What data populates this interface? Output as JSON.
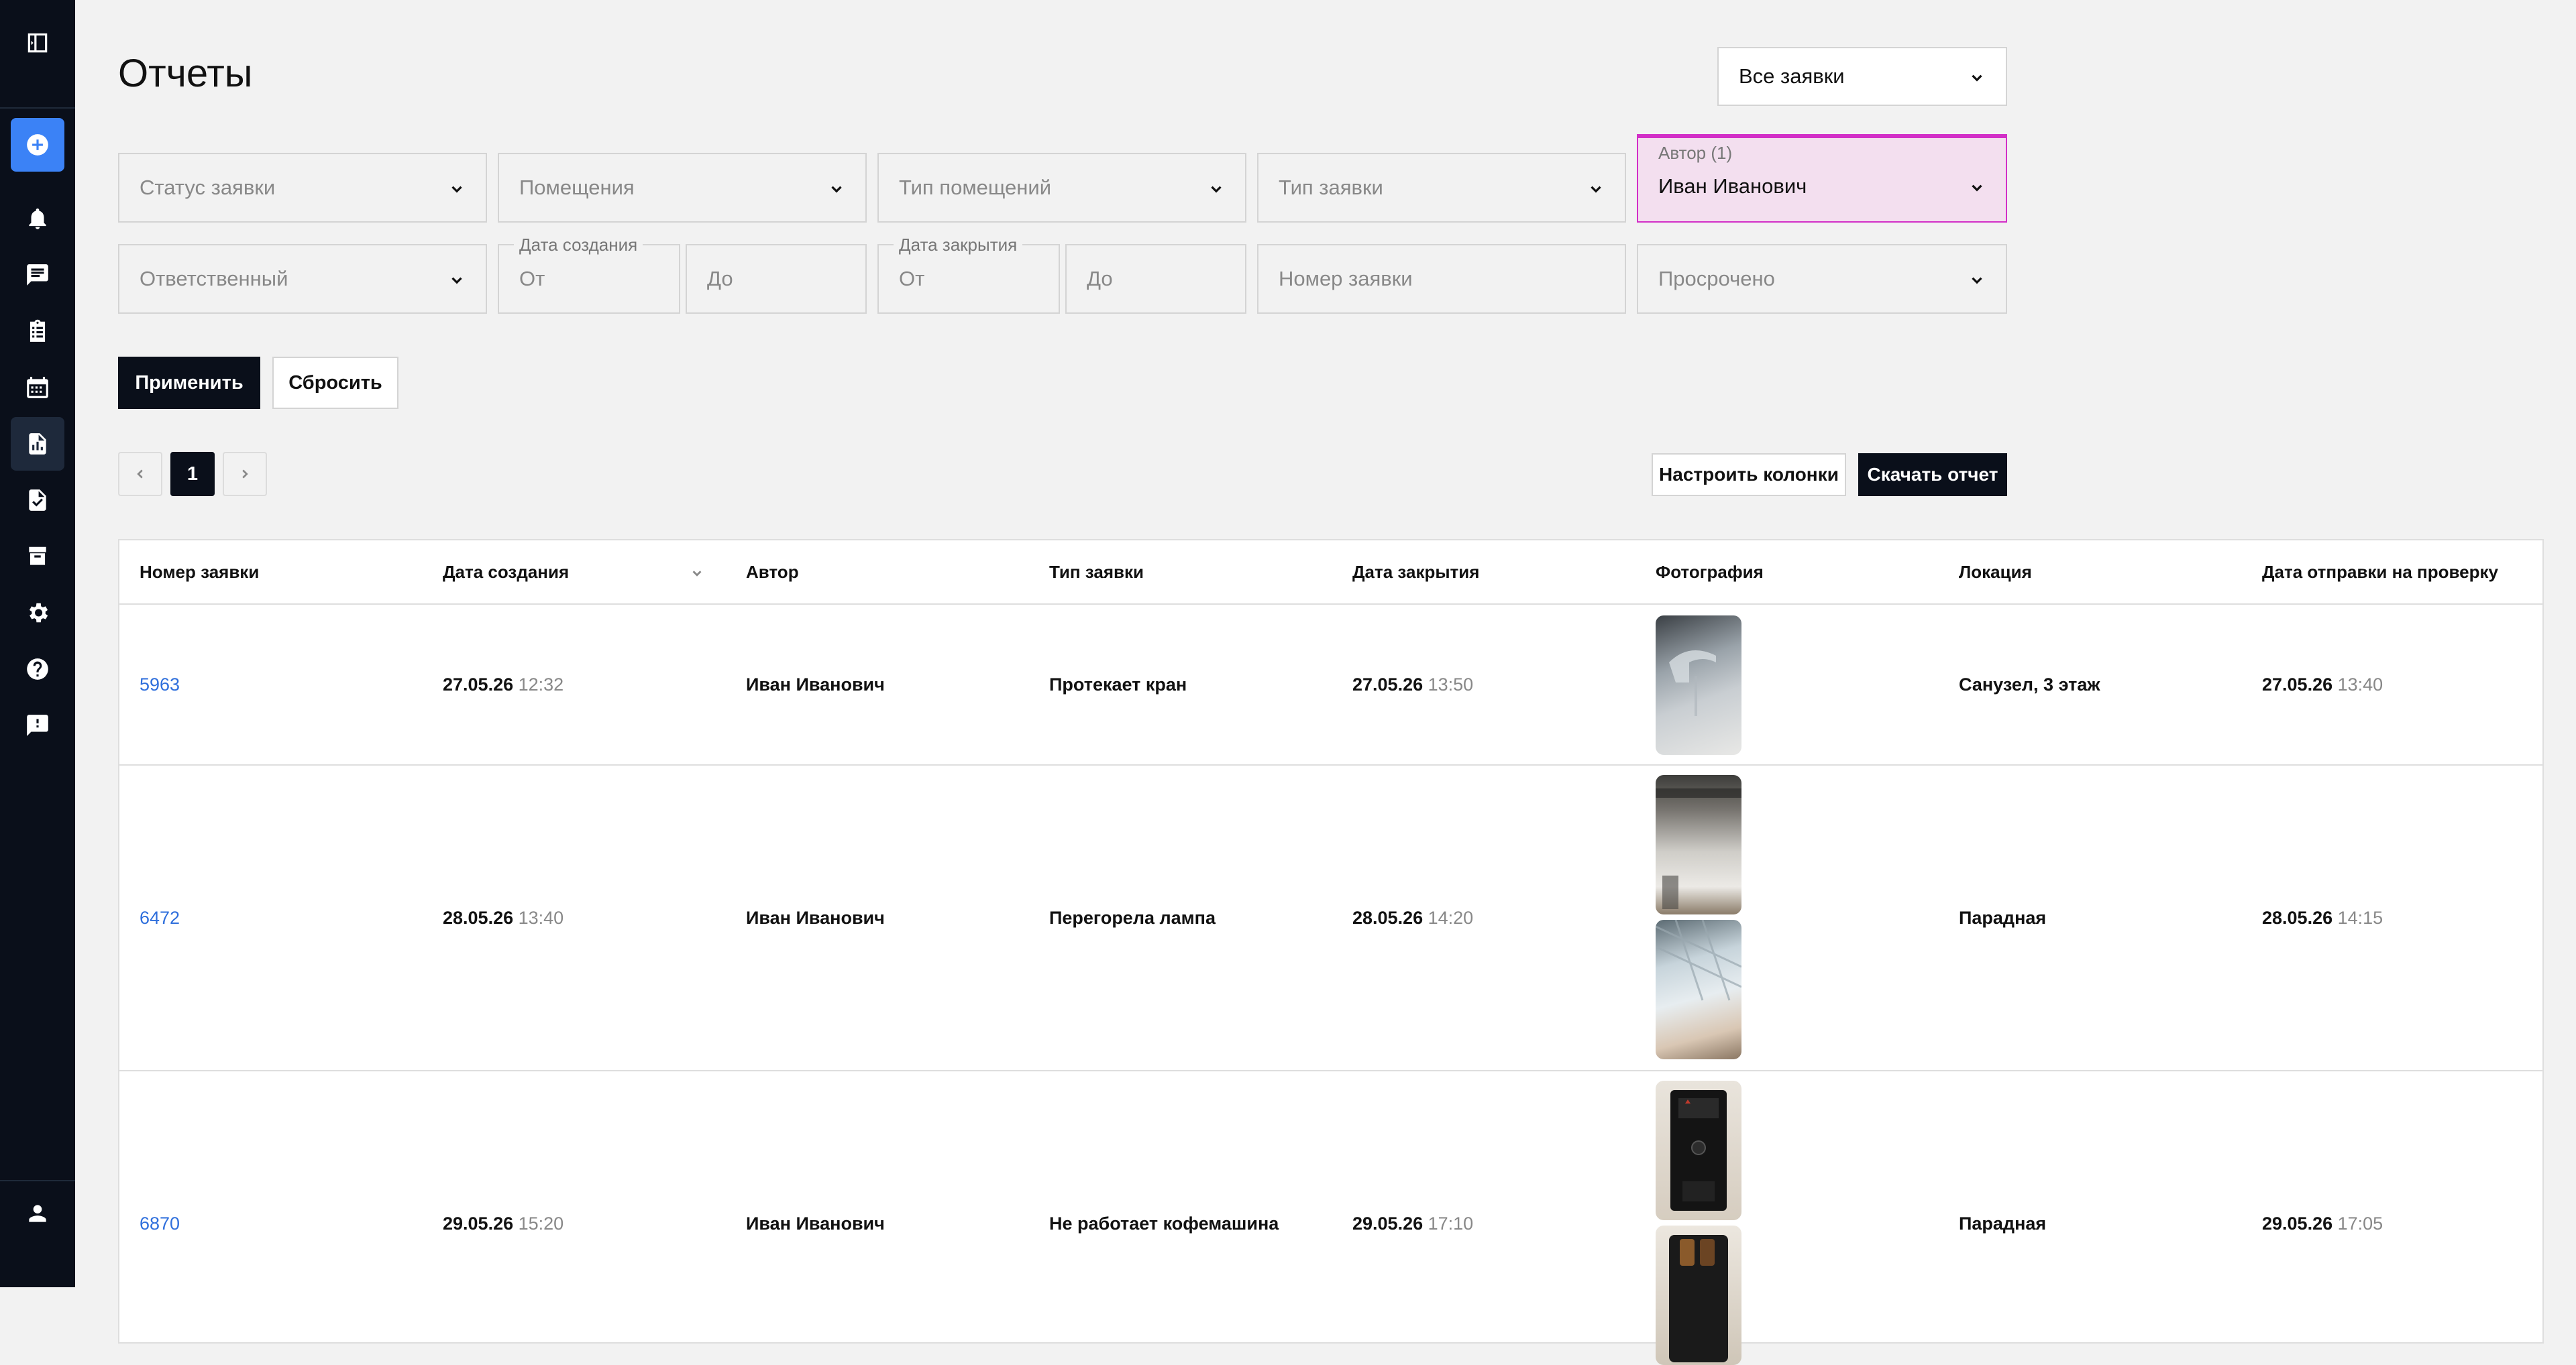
{
  "page": {
    "title": "Отчеты"
  },
  "top_select": {
    "value": "Все заявки"
  },
  "filters": {
    "status": {
      "placeholder": "Статус заявки"
    },
    "rooms": {
      "placeholder": "Помещения"
    },
    "room_type": {
      "placeholder": "Тип помещений"
    },
    "request_type": {
      "placeholder": "Тип заявки"
    },
    "author": {
      "label": "Автор (1)",
      "value": "Иван Иванович"
    },
    "responsible": {
      "placeholder": "Ответственный"
    },
    "created": {
      "label": "Дата создания",
      "from": "От",
      "to": "До"
    },
    "closed": {
      "label": "Дата закрытия",
      "from": "От",
      "to": "До"
    },
    "request_number": {
      "placeholder": "Номер заявки"
    },
    "overdue": {
      "placeholder": "Просрочено"
    }
  },
  "actions": {
    "apply": "Применить",
    "reset": "Сбросить",
    "configure_columns": "Настроить колонки",
    "download_report": "Скачать отчет"
  },
  "pagination": {
    "current": "1"
  },
  "table": {
    "columns": [
      "Номер заявки",
      "Дата создания",
      "Автор",
      "Тип заявки",
      "Дата закрытия",
      "Фотография",
      "Локация",
      "Дата отправки на проверку"
    ],
    "rows": [
      {
        "number": "5963",
        "created_date": "27.05.26",
        "created_time": "12:32",
        "author": "Иван Иванович",
        "type": "Протекает кран",
        "closed_date": "27.05.26",
        "closed_time": "13:50",
        "location": "Санузел, 3 этаж",
        "sent_date": "27.05.26",
        "sent_time": "13:40"
      },
      {
        "number": "6472",
        "created_date": "28.05.26",
        "created_time": "13:40",
        "author": "Иван Иванович",
        "type": "Перегорела лампа",
        "closed_date": "28.05.26",
        "closed_time": "14:20",
        "location": "Парадная",
        "sent_date": "28.05.26",
        "sent_time": "14:15"
      },
      {
        "number": "6870",
        "created_date": "29.05.26",
        "created_time": "15:20",
        "author": "Иван Иванович",
        "type": "Не работает кофемашина",
        "closed_date": "29.05.26",
        "closed_time": "17:10",
        "location": "Парадная",
        "sent_date": "29.05.26",
        "sent_time": "17:05"
      }
    ]
  }
}
